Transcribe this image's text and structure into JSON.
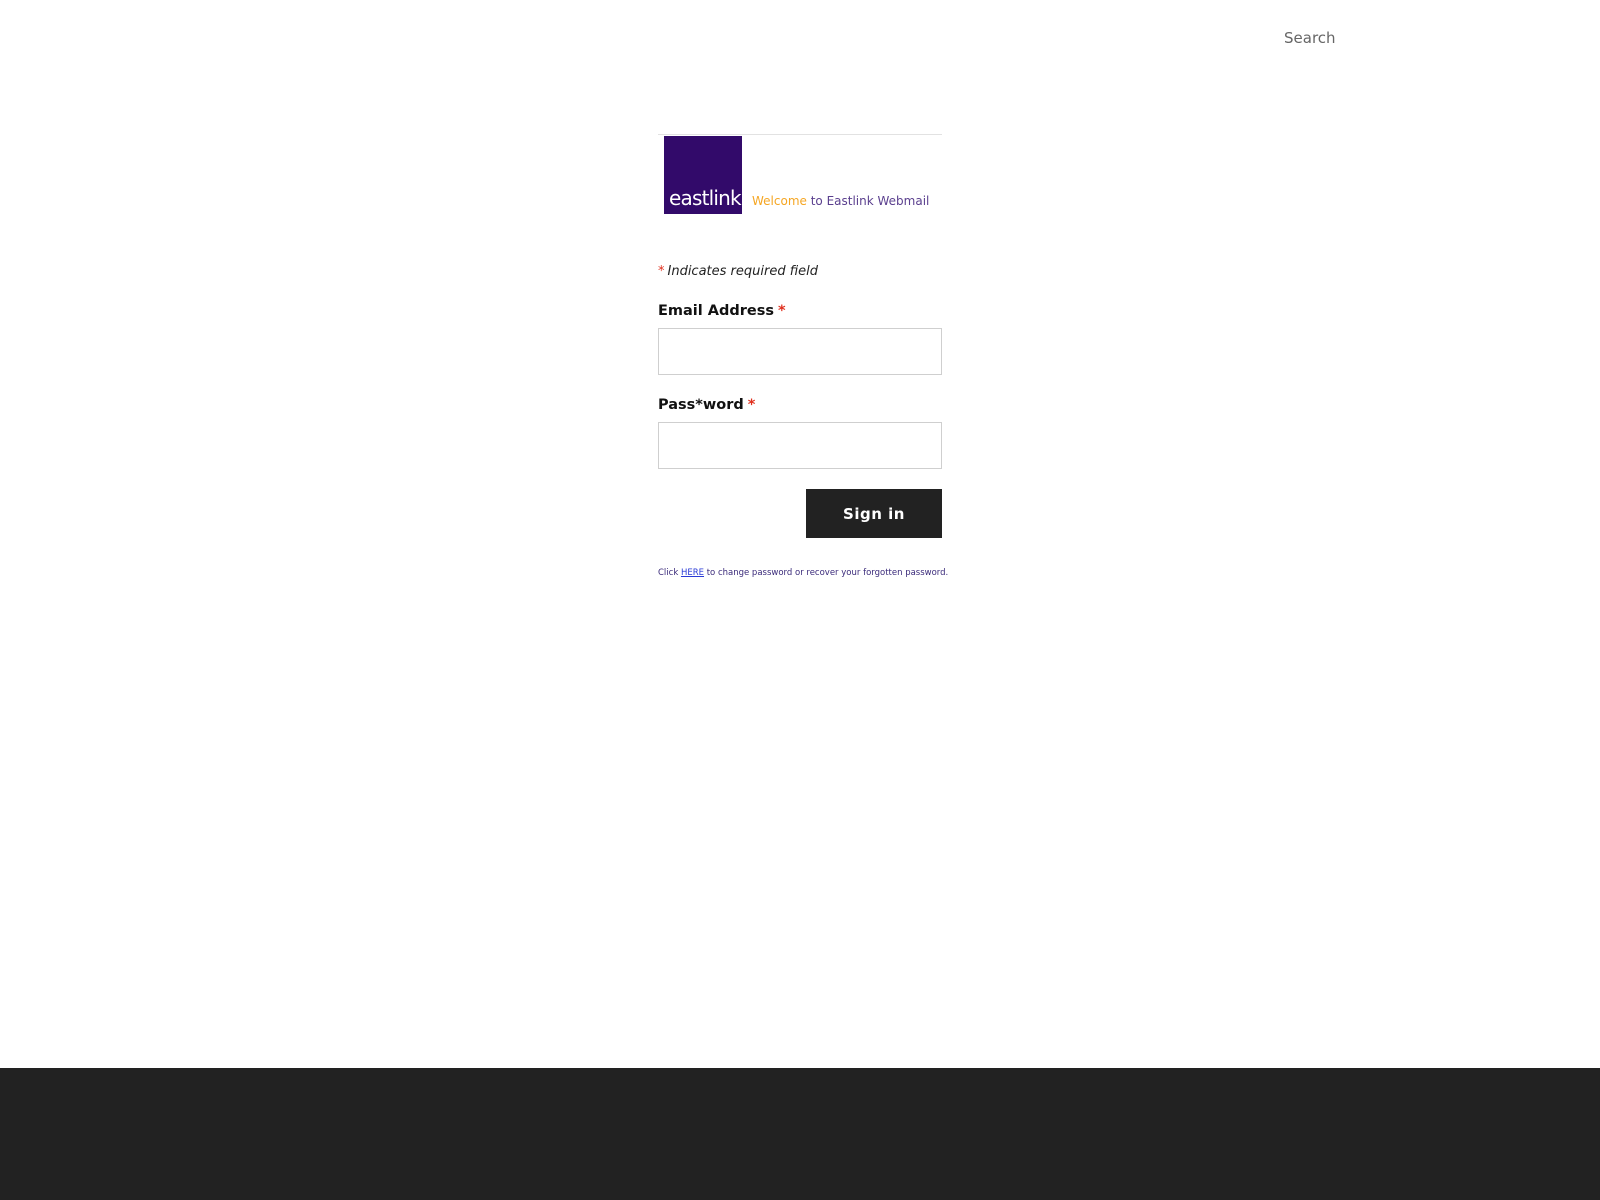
{
  "header": {
    "search_placeholder": "Search"
  },
  "banner": {
    "logo_text": "eastlink",
    "welcome_highlight": "Welcome",
    "welcome_rest": " to Eastlink Webmail"
  },
  "form": {
    "required_star": "*",
    "required_note": "Indicates required field",
    "email_label": "Email Address",
    "email_value": "",
    "password_label": "Pass*word",
    "password_value": "",
    "submit_label": "Sign in"
  },
  "help": {
    "prefix": "Click ",
    "link_text": "HERE",
    "suffix": " to change password or recover your forgotten password."
  },
  "colors": {
    "brand_purple": "#320a6a",
    "welcome_orange": "#f5a623",
    "required_red": "#e0301e",
    "button_dark": "#222222",
    "footer_dark": "#222222"
  }
}
